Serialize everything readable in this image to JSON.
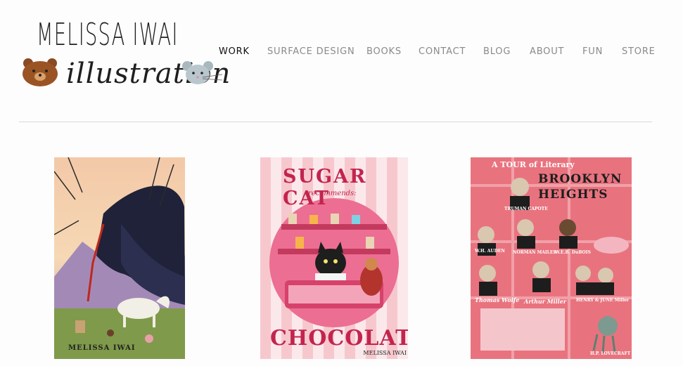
{
  "logo": {
    "title": "MELISSA IWAI",
    "subtitle": "illustration"
  },
  "nav": {
    "items": [
      {
        "label": "WORK"
      },
      {
        "label": "SURFACE DESIGN"
      },
      {
        "label": "BOOKS"
      },
      {
        "label": "CONTACT"
      },
      {
        "label": "BLOG"
      },
      {
        "label": "ABOUT"
      },
      {
        "label": "FUN"
      },
      {
        "label": "STORE"
      }
    ]
  },
  "gallery": {
    "items": [
      {
        "signature": "MELISSA IWAI",
        "icon": "dragon-unicorn-illustration"
      },
      {
        "heading": "SUGAR CAT",
        "subheading": "recommends:",
        "footer": "CHOCOLATE",
        "signature": "MELISSA IWAI",
        "icon": "sugar-cat-illustration"
      },
      {
        "heading_small": "A TOUR of Literary",
        "heading": "BROOKLYN HEIGHTS",
        "labels": [
          "TRUMAN CAPOTE",
          "W.H. AUDEN",
          "NORMAN MAILER",
          "W.E.B. DuBOIS",
          "Thomas Wolfe",
          "Arthur Miller",
          "HENRY & JUNE Miller",
          "H.P. LOVECRAFT"
        ],
        "icon": "brooklyn-map-illustration"
      }
    ]
  }
}
